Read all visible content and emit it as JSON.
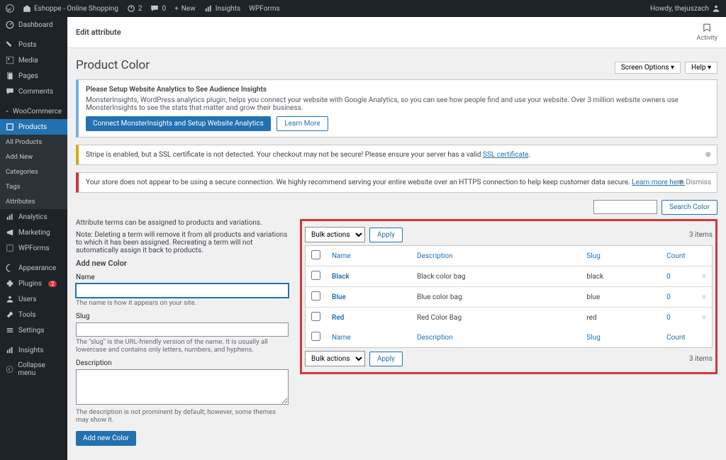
{
  "adminbar": {
    "site_name": "Eshoppe - Online Shopping",
    "updates": "2",
    "comments": "0",
    "new": "New",
    "insights": "Insights",
    "wpforms": "WPForms",
    "howdy": "Howdy, thejuszach"
  },
  "sidebar": {
    "dashboard": "Dashboard",
    "posts": "Posts",
    "media": "Media",
    "pages": "Pages",
    "comments": "Comments",
    "woocommerce": "WooCommerce",
    "products": "Products",
    "sub_all": "All Products",
    "sub_addnew": "Add New",
    "sub_categories": "Categories",
    "sub_tags": "Tags",
    "sub_attributes": "Attributes",
    "analytics": "Analytics",
    "marketing": "Marketing",
    "wpforms": "WPForms",
    "appearance": "Appearance",
    "plugins": "Plugins",
    "plugins_count": "2",
    "users": "Users",
    "tools": "Tools",
    "settings": "Settings",
    "insights": "Insights",
    "collapse": "Collapse menu"
  },
  "header": {
    "edit_attribute": "Edit attribute",
    "activity": "Activity",
    "screen_options": "Screen Options",
    "help": "Help",
    "title": "Product Color"
  },
  "notice_mi": {
    "title": "Please Setup Website Analytics to See Audience Insights",
    "body": "MonsterInsights, WordPress analytics plugin, helps you connect your website with Google Analytics, so you can see how people find and use your website. Over 3 million website owners use MonsterInsights to see the stats that matter and grow their business.",
    "btn_primary": "Connect MonsterInsights and Setup Website Analytics",
    "btn_secondary": "Learn More"
  },
  "notice_stripe": {
    "body": "Stripe is enabled, but a SSL certificate is not detected. Your checkout may not be secure! Please ensure your server has a valid ",
    "link": "SSL certificate"
  },
  "notice_https": {
    "body": "Your store does not appear to be using a secure connection. We highly recommend serving your entire website over an HTTPS connection to help keep customer data secure. ",
    "link": "Learn more here.",
    "dismiss": "Dismiss"
  },
  "form": {
    "intro1": "Attribute terms can be assigned to products and variations.",
    "intro2": "Note: Deleting a term will remove it from all products and variations to which it has been assigned. Recreating a term will not automatically assign it back to products.",
    "add_new_heading": "Add new Color",
    "name_label": "Name",
    "name_help": "The name is how it appears on your site.",
    "slug_label": "Slug",
    "slug_help": "The \"slug\" is the URL-friendly version of the name. It is usually all lowercase and contains only letters, numbers, and hyphens.",
    "desc_label": "Description",
    "desc_help": "The description is not prominent by default; however, some themes may show it.",
    "submit": "Add new Color"
  },
  "table": {
    "search_btn": "Search Color",
    "bulk_label": "Bulk actions",
    "apply": "Apply",
    "items": "3 items",
    "col_name": "Name",
    "col_desc": "Description",
    "col_slug": "Slug",
    "col_count": "Count",
    "rows": [
      {
        "name": "Black",
        "desc": "Black color bag",
        "slug": "black",
        "count": "0"
      },
      {
        "name": "Blue",
        "desc": "Blue color bag",
        "slug": "blue",
        "count": "0"
      },
      {
        "name": "Red",
        "desc": "Red Color Bag",
        "slug": "red",
        "count": "0"
      }
    ]
  }
}
